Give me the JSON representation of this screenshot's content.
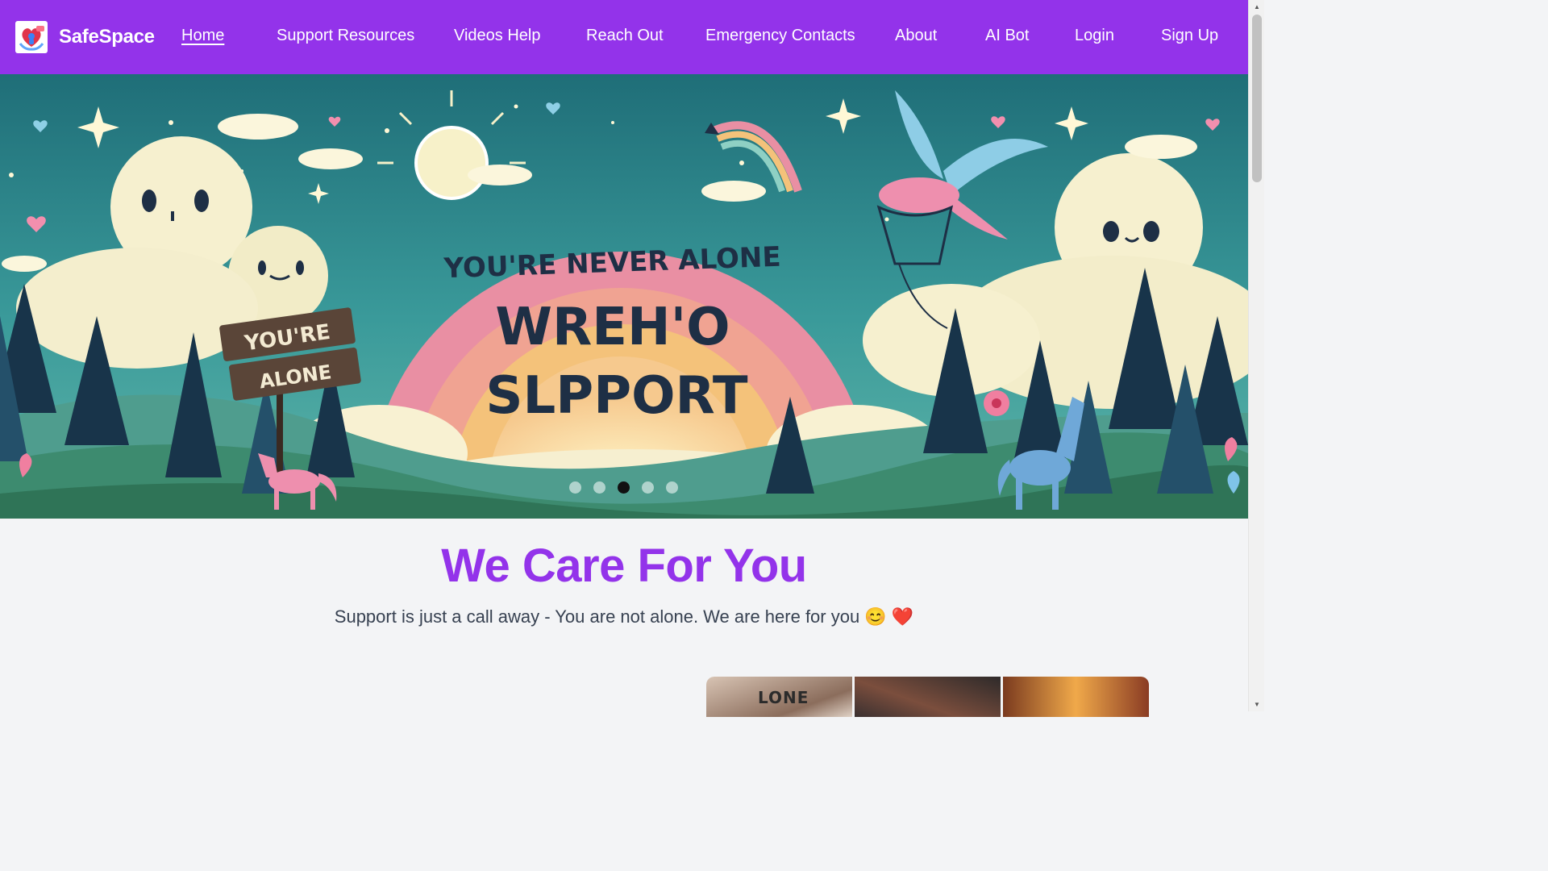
{
  "brand": {
    "name": "SafeSpace",
    "logo_icon": "heart-hands-logo"
  },
  "nav": {
    "items": [
      {
        "label": "Home",
        "active": true
      },
      {
        "label": "Support Resources"
      },
      {
        "label": "Videos Help"
      },
      {
        "label": "Reach Out"
      },
      {
        "label": "Emergency Contacts"
      },
      {
        "label": "About"
      },
      {
        "label": "AI Bot"
      },
      {
        "label": "Login"
      },
      {
        "label": "Sign Up"
      }
    ]
  },
  "hero": {
    "banner_text": [
      "YOU'RE NEVER ALONE",
      "WREH'O",
      "SLPPORT"
    ],
    "sign_text": [
      "YOU'RE",
      "ALONE"
    ],
    "carousel": {
      "slide_count": 5,
      "active_index": 2
    }
  },
  "care": {
    "title": "We Care For You",
    "subtitle": "Support is just a call away - You are not alone. We are here for you 😊 ❤️"
  },
  "gallery": {
    "first_image_text": "LONE"
  },
  "colors": {
    "brand_purple": "#9333ea",
    "page_bg": "#f3f4f6",
    "hero_teal": "#2f8a8f",
    "rainbow_pink": "#e98fa3"
  }
}
